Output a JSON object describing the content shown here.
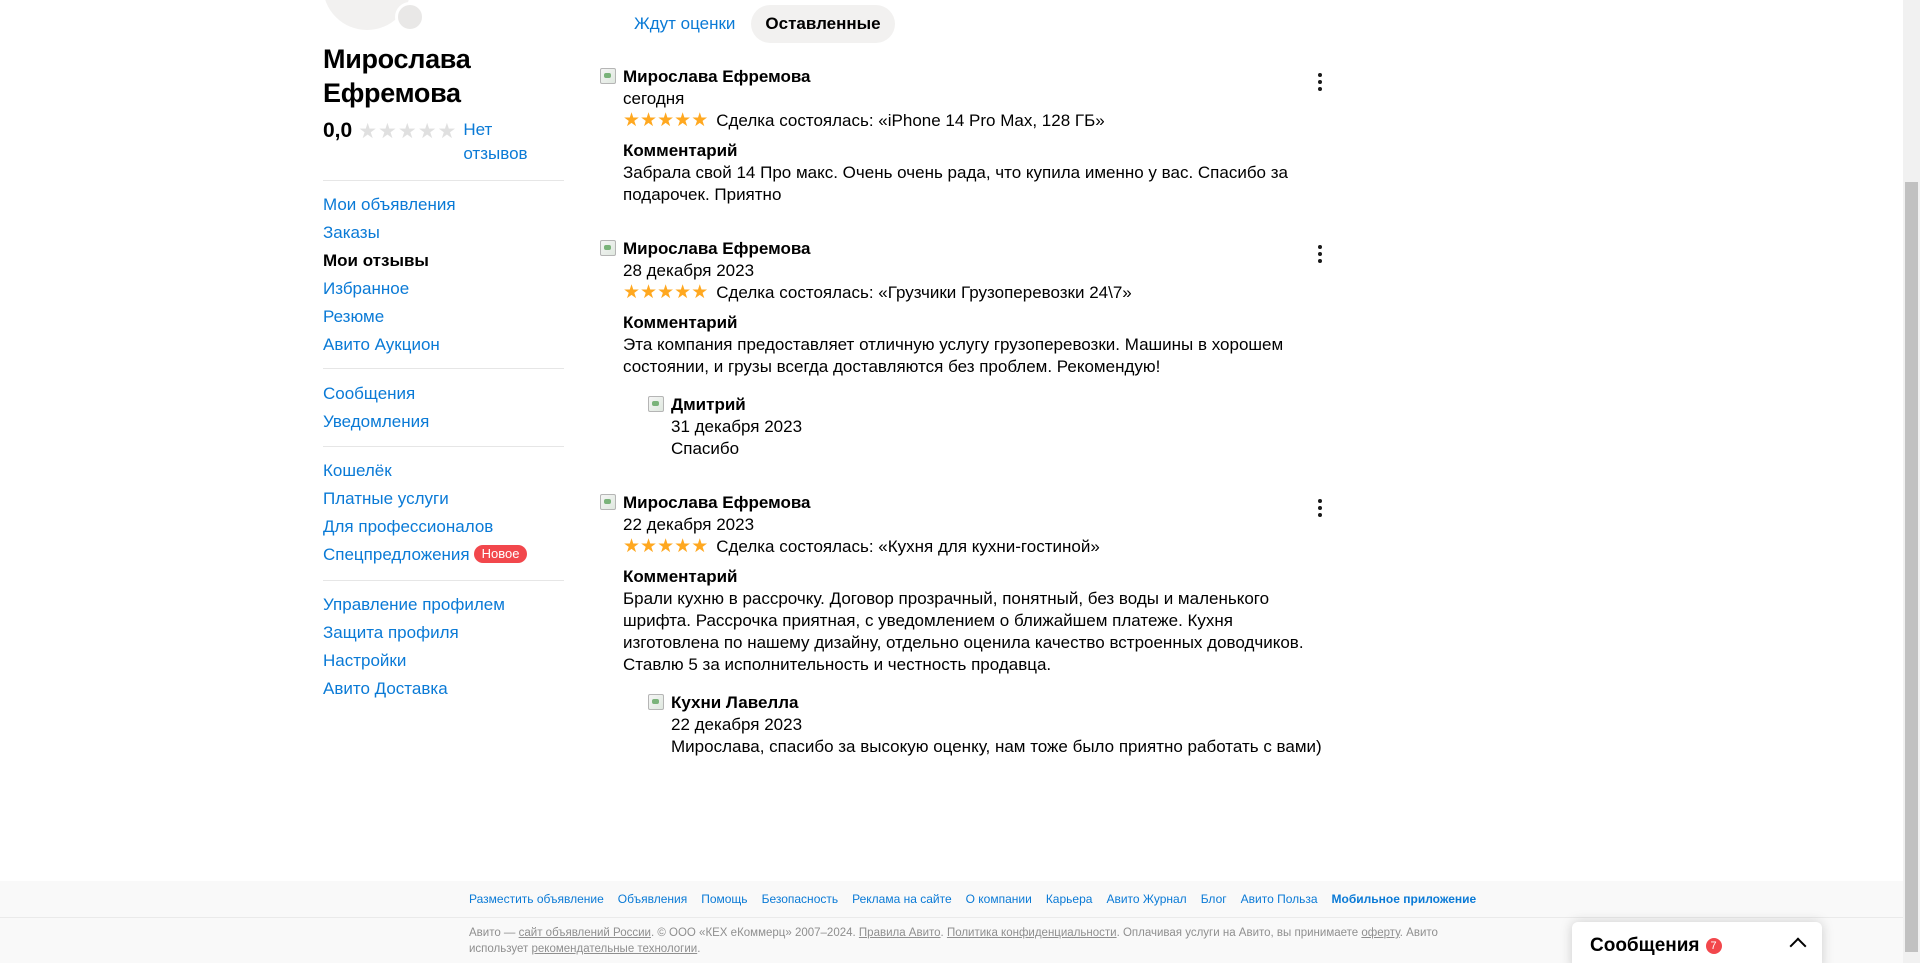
{
  "profile": {
    "name": "Мирослава Ефремова",
    "rating": "0,0",
    "no_reviews": "Нет отзывов"
  },
  "menu": {
    "group1": [
      {
        "label": "Мои объявления"
      },
      {
        "label": "Заказы"
      },
      {
        "label": "Мои отзывы",
        "active": true
      },
      {
        "label": "Избранное"
      },
      {
        "label": "Резюме"
      },
      {
        "label": "Авито Аукцион"
      }
    ],
    "group2": [
      {
        "label": "Сообщения"
      },
      {
        "label": "Уведомления"
      }
    ],
    "group3": [
      {
        "label": "Кошелёк"
      },
      {
        "label": "Платные услуги"
      },
      {
        "label": "Для профессионалов"
      },
      {
        "label": "Спецпредложения",
        "badge": "Новое"
      }
    ],
    "group4": [
      {
        "label": "Управление профилем"
      },
      {
        "label": "Защита профиля"
      },
      {
        "label": "Настройки"
      },
      {
        "label": "Авито Доставка"
      }
    ]
  },
  "tabs": {
    "pending": "Ждут оценки",
    "left": "Оставленные"
  },
  "reviews": [
    {
      "author": "Мирослава Ефремова",
      "date": "сегодня",
      "rating": 5,
      "deal": "Сделка состоялась: «iPhone 14 Pro Max, 128 ГБ»",
      "comment_title": "Комментарий",
      "comment": "Забрала свой 14 Про макс. Очень очень рада, что купила именно у вас. Спасибо за подарочек. Приятно"
    },
    {
      "author": "Мирослава Ефремова",
      "date": "28 декабря 2023",
      "rating": 5,
      "deal": "Сделка состоялась: «Грузчики Грузоперевозки 24\\7»",
      "comment_title": "Комментарий",
      "comment": "Эта компания предоставляет отличную услугу грузоперевозки. Машины в хорошем состоянии, и грузы всегда доставляются без проблем. Рекомендую!",
      "reply": {
        "author": "Дмитрий",
        "date": "31 декабря 2023",
        "text": "Спасибо"
      }
    },
    {
      "author": "Мирослава Ефремова",
      "date": "22 декабря 2023",
      "rating": 5,
      "deal": "Сделка состоялась: «Кухня для кухни-гостиной»",
      "comment_title": "Комментарий",
      "comment": "Брали кухню в рассрочку. Договор прозрачный, понятный, без воды и маленького шрифта. Рассрочка приятная, с уведомлением о ближайшем платеже. Кухня изготовлена по нашему дизайну, отдельно оценила качество встроенных доводчиков. Ставлю 5 за исполнительность и честность продавца.",
      "reply": {
        "author": "Кухни Лавелла",
        "date": "22 декабря 2023",
        "text": "Мирослава, спасибо за высокую оценку, нам тоже было приятно работать с вами)"
      }
    }
  ],
  "footer": {
    "links": [
      "Разместить объявление",
      "Объявления",
      "Помощь",
      "Безопасность",
      "Реклама на сайте",
      "О компании",
      "Карьера",
      "Авито Журнал",
      "Блог",
      "Авито Польза",
      "Мобильное приложение"
    ],
    "legal": {
      "p1": "Авито — ",
      "link1": "сайт объявлений России",
      "p2": ". © ООО «КЕХ еКоммерц» 2007–2024. ",
      "link2": "Правила Авито",
      "p3": ". ",
      "link3": "Политика конфиденциальности",
      "p4": ". Оплачивая услуги на Авито, вы принимаете ",
      "link4": "оферту",
      "p5": ". Авито использует ",
      "link5": "рекомендательные технологии",
      "p6": "."
    }
  },
  "messenger": {
    "title": "Сообщения",
    "count": "7"
  },
  "colors": {
    "link": "#0a7ad6",
    "star": "#ffa820",
    "badge": "#f2474c"
  }
}
